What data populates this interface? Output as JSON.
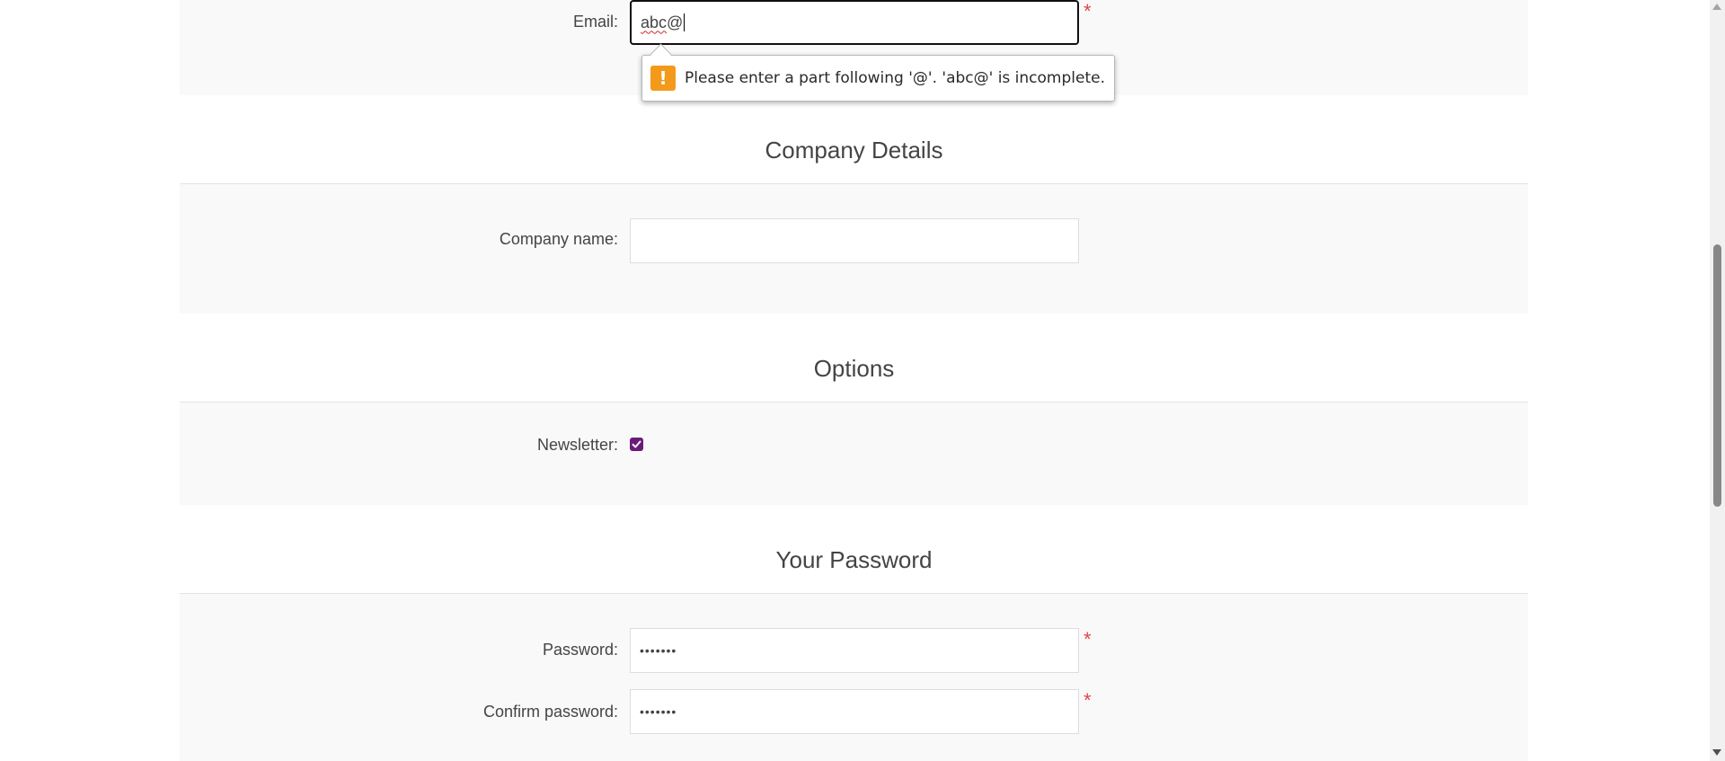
{
  "contact": {
    "email_label": "Email:",
    "email_value": "abc",
    "email_value_suffix": "@",
    "required_mark": "*"
  },
  "validation": {
    "message": "Please enter a part following '@'. 'abc@' is incomplete.",
    "icon": "warning-icon",
    "icon_glyph": "!",
    "icon_color": "#f39a1b"
  },
  "company_section": {
    "title": "Company Details",
    "company_name_label": "Company name:",
    "company_name_value": ""
  },
  "options_section": {
    "title": "Options",
    "newsletter_label": "Newsletter:",
    "newsletter_checked": true,
    "checkbox_color": "#6a1b7a"
  },
  "password_section": {
    "title": "Your Password",
    "password_label": "Password:",
    "password_value": "•••••••",
    "confirm_label": "Confirm password:",
    "confirm_value": "•••••••",
    "required_mark": "*"
  },
  "colors": {
    "required": "#e4434b",
    "panel_bg": "#f9f9f9"
  }
}
